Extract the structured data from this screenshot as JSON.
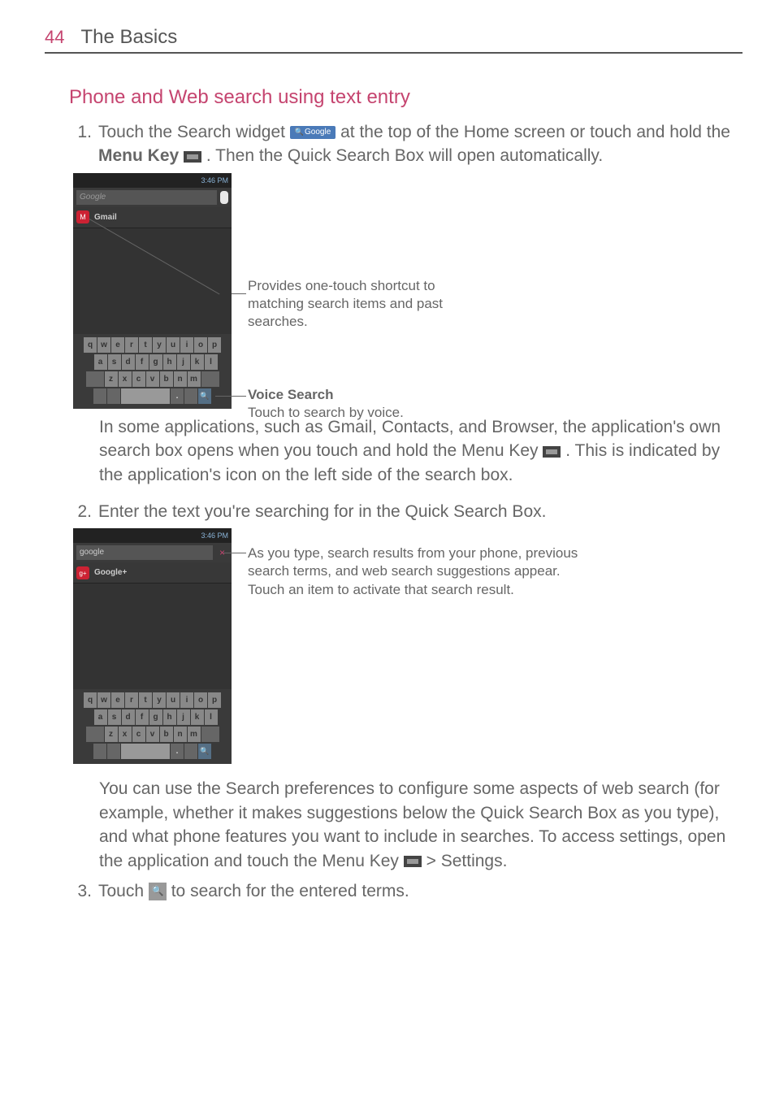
{
  "page": {
    "number": "44",
    "title": "The Basics"
  },
  "section_heading": "Phone and Web search using text entry",
  "step1": {
    "number": "1.",
    "part_a": " Touch the Search widget ",
    "widget_label": "Google",
    "part_b": " at the top of the Home screen or touch and hold the ",
    "menu_key": "Menu Key",
    "part_c": " ",
    "part_d": ". Then the Quick Search Box will open automatically."
  },
  "screenshot1": {
    "time": "3:46 PM",
    "search_placeholder": "Google",
    "suggestion": "Gmail",
    "kb_row1": [
      "q",
      "w",
      "e",
      "r",
      "t",
      "y",
      "u",
      "i",
      "o",
      "p"
    ],
    "kb_row2": [
      "a",
      "s",
      "d",
      "f",
      "g",
      "h",
      "j",
      "k",
      "l"
    ],
    "kb_row3": [
      "z",
      "x",
      "c",
      "v",
      "b",
      "n",
      "m"
    ]
  },
  "callouts1": {
    "shortcut": "Provides one-touch shortcut to matching search items and past searches.",
    "voice_title": "Voice Search",
    "voice_body": "Touch to search by voice."
  },
  "after_fig1": {
    "a": "In some applications, such as Gmail, Contacts, and Browser, the application's own search box opens when you touch and hold the ",
    "menu": "Menu Key",
    "b": " ",
    "c": ". This is indicated by the application's icon on the left side of the search box."
  },
  "step2": {
    "number": "2.",
    "text": " Enter the text you're searching for in the Quick Search Box."
  },
  "screenshot2": {
    "time": "3:46 PM",
    "typed": "google",
    "suggestion": "Google+",
    "kb_row1": [
      "q",
      "w",
      "e",
      "r",
      "t",
      "y",
      "u",
      "i",
      "o",
      "p"
    ],
    "kb_row2": [
      "a",
      "s",
      "d",
      "f",
      "g",
      "h",
      "j",
      "k",
      "l"
    ],
    "kb_row3": [
      "z",
      "x",
      "c",
      "v",
      "b",
      "n",
      "m"
    ]
  },
  "callouts2": {
    "results": "As you type, search results from your phone, previous search terms, and web search suggestions appear. Touch an item to activate that search result."
  },
  "after_fig2": {
    "a": "You can use the Search preferences to configure some aspects of web search (for example, whether it makes suggestions below the Quick Search Box as you type), and what phone features you want to include in searches. To access settings, open the application and touch the ",
    "menu": "Menu Key",
    "b": " ",
    "arrow": " > ",
    "settings": "Settings."
  },
  "step3": {
    "number": "3.",
    "a": " Touch ",
    "b": " to search for the entered terms."
  }
}
